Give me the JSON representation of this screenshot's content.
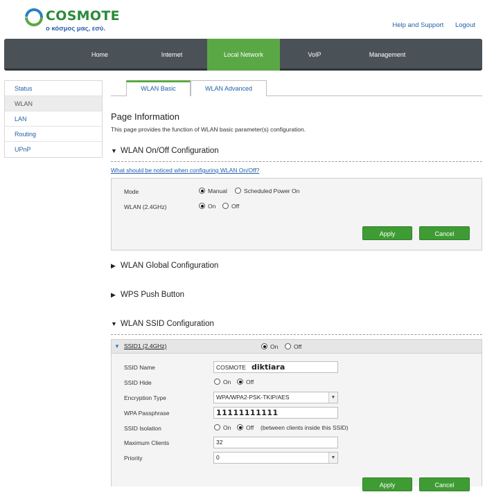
{
  "brand": {
    "name": "COSMOTE",
    "tagline": "ο κόσμος μας, εσύ."
  },
  "toplinks": {
    "help": "Help and Support",
    "logout": "Logout"
  },
  "nav": [
    "Home",
    "Internet",
    "Local Network",
    "VoIP",
    "Management"
  ],
  "sidebar": [
    "Status",
    "WLAN",
    "LAN",
    "Routing",
    "UPnP"
  ],
  "tabs": [
    "WLAN Basic",
    "WLAN Advanced"
  ],
  "page": {
    "title": "Page Information",
    "desc": "This page provides the function of WLAN basic parameter(s) configuration."
  },
  "sections": {
    "onoff": "WLAN On/Off Configuration",
    "help_link": "What should be noticed when configuring WLAN On/Off?",
    "global": "WLAN Global Configuration",
    "wps": "WPS Push Button",
    "ssid": "WLAN SSID Configuration"
  },
  "onoff": {
    "mode_label": "Mode",
    "mode_manual": "Manual",
    "mode_sched": "Scheduled Power On",
    "wlan_label": "WLAN (2.4GHz)",
    "on": "On",
    "off": "Off"
  },
  "buttons": {
    "apply": "Apply",
    "cancel": "Cancel"
  },
  "ssid": {
    "header": "SSID1 (2.4GHz)",
    "on": "On",
    "off": "Off",
    "labels": {
      "name": "SSID Name",
      "hide": "SSID Hide",
      "enc": "Encryption Type",
      "pass": "WPA Passphrase",
      "iso": "SSID Isolation",
      "max": "Maximum Clients",
      "prio": "Priority"
    },
    "name_prefix": "COSMOTE",
    "name_suffix": "diktiara",
    "encryption": "WPA/WPA2-PSK-TKIP/AES",
    "passphrase": "11111111111",
    "iso_note": "(between clients inside this SSID)",
    "max_clients": "32",
    "priority": "0"
  },
  "colors": {
    "accent": "#5aa845",
    "nav_bg": "#4a5257",
    "link": "#1f5fa8",
    "button": "#3f9c34"
  }
}
